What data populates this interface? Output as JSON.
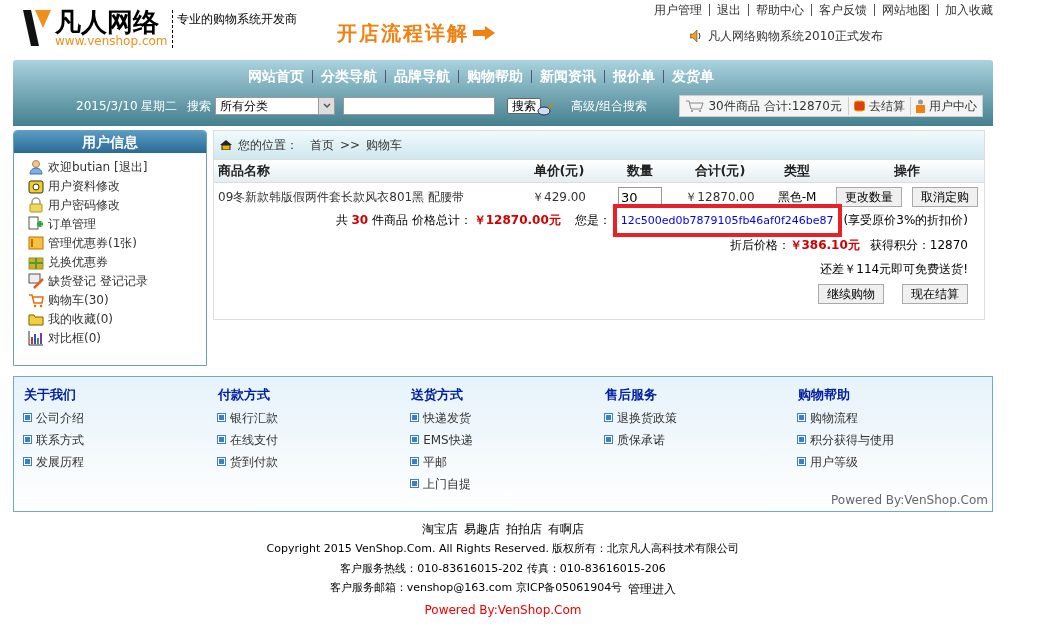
{
  "logo": {
    "name": "凡人网络",
    "url": "www.venshop.com"
  },
  "tagline": "专业的购物系统开发商",
  "promo": "开店流程详解",
  "top_links": [
    "用户管理",
    "退出",
    "帮助中心",
    "客户反馈",
    "网站地图",
    "加入收藏"
  ],
  "announcement": "凡人网络购物系统2010正式发布",
  "nav": [
    "网站首页",
    "分类导航",
    "品牌导航",
    "购物帮助",
    "新闻资讯",
    "报价单",
    "发货单"
  ],
  "search_bar": {
    "date": "2015/3/10 星期二",
    "label": "搜索",
    "category": "所有分类",
    "button": "搜索",
    "advanced": "高级/组合搜索"
  },
  "cart_summary": {
    "count": "30件商品",
    "total": "合计:12870元",
    "checkout": "去结算",
    "user_center": "用户中心"
  },
  "user_panel": {
    "title": "用户信息",
    "items": [
      {
        "kind": "user",
        "text": "欢迎butian [退出]"
      },
      {
        "kind": "phone",
        "text": "用户资料修改"
      },
      {
        "kind": "lock",
        "text": "用户密码修改"
      },
      {
        "kind": "add",
        "text": "订单管理"
      },
      {
        "kind": "coupon",
        "text": "管理优惠券(1张)"
      },
      {
        "kind": "gift",
        "text": "兑换优惠券"
      },
      {
        "kind": "note",
        "text": "缺货登记 登记记录"
      },
      {
        "kind": "cart",
        "text": "购物车(30)"
      },
      {
        "kind": "folder",
        "text": "我的收藏(0)"
      },
      {
        "kind": "chart",
        "text": "对比框(0)"
      }
    ]
  },
  "breadcrumb": {
    "label": "您的位置：",
    "home": "首页",
    "separator": ">>",
    "current": "购物车"
  },
  "cart_table": {
    "columns": [
      "商品名称",
      "单价(元)",
      "数量",
      "合计(元)",
      "类型",
      "操作"
    ],
    "rows": [
      {
        "name": "09冬新款韩版假两件套长款风衣801黑 配腰带",
        "price": "￥429.00",
        "quantity": "30",
        "total": "￥12870.00",
        "type": "黑色-M",
        "actions": [
          "更改数量",
          "取消定购"
        ]
      }
    ]
  },
  "summary": {
    "prefix": "共",
    "count": "30",
    "suffix": "件商品 价格总计：",
    "total": "￥12870.00元",
    "member_label": "您是：",
    "member_id": "12c500ed0b7879105fb46af0f246be87",
    "member_highlighted": true,
    "discount_note": "(享受原价3%的折扣价)",
    "discount_label": "折后价格：",
    "discount_price": "￥386.10元",
    "points_label": "获得积分：",
    "points": "12870",
    "free_shipping": "还差￥114元即可免费送货!",
    "buttons": [
      "继续购物",
      "现在结算"
    ]
  },
  "footer_columns": [
    {
      "title": "关于我们",
      "links": [
        "公司介绍",
        "联系方式",
        "发展历程"
      ]
    },
    {
      "title": "付款方式",
      "links": [
        "银行汇款",
        "在线支付",
        "货到付款"
      ]
    },
    {
      "title": "送货方式",
      "links": [
        "快递发货",
        "EMS快递",
        "平邮",
        "上门自提"
      ]
    },
    {
      "title": "售后服务",
      "links": [
        "退换货政策",
        "质保承诺"
      ]
    },
    {
      "title": "购物帮助",
      "links": [
        "购物流程",
        "积分获得与使用",
        "用户等级"
      ]
    }
  ],
  "footer_powered": "Powered By:VenShop.Com",
  "bottom": {
    "stores": [
      "淘宝店",
      "易趣店",
      "拍拍店",
      "有啊店"
    ],
    "copyright": "Copyright 2015 VenShop.Com. All Rights Reserved. 版权所有：北京凡人高科技术有限公司",
    "hotline": "客户服务热线：010-83616015-202 传真：010-83616015-206",
    "email": "客户服务邮箱：venshop@163.com 京ICP备05061904号",
    "admin": "管理进入",
    "powered": "Powered By:VenShop.Com"
  }
}
